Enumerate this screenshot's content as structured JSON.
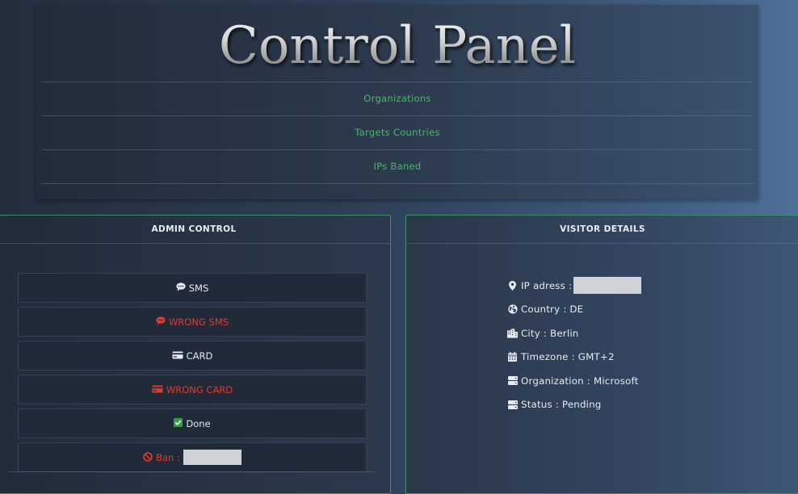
{
  "header": {
    "title": "Control Panel",
    "nav": [
      {
        "label": "Organizations"
      },
      {
        "label": "Targets Countries"
      },
      {
        "label": "IPs Baned"
      }
    ]
  },
  "admin": {
    "heading": "ADMIN CONTROL",
    "buttons": {
      "sms": {
        "label": "SMS",
        "icon": "chat-bubble-icon",
        "color": "#e6e9ee"
      },
      "wrong_sms": {
        "label": "WRONG SMS",
        "icon": "chat-bubble-icon",
        "color": "#e03a2f"
      },
      "card": {
        "label": "CARD",
        "icon": "credit-card-icon",
        "color": "#e6e9ee"
      },
      "wrong_card": {
        "label": "WRONG CARD",
        "icon": "credit-card-icon",
        "color": "#e03a2f"
      },
      "done": {
        "label": "Done",
        "icon": "checkbox-icon",
        "color": "#35a04a"
      },
      "ban": {
        "label": "Ban :",
        "icon": "ban-icon",
        "color": "#e03a2f"
      }
    }
  },
  "visitor": {
    "heading": "VISITOR DETAILS",
    "ip": {
      "label": "IP adress :",
      "icon": "map-marker-icon"
    },
    "country": {
      "label": "Country :",
      "value": "DE",
      "icon": "globe-icon"
    },
    "city": {
      "label": "City :",
      "value": "Berlin",
      "icon": "city-icon"
    },
    "timezone": {
      "label": "Timezone :",
      "value": "GMT+2",
      "icon": "calendar-icon"
    },
    "organization": {
      "label": "Organization :",
      "value": "Microsoft",
      "icon": "server-icon"
    },
    "status": {
      "label": "Status :",
      "value": "Pending",
      "icon": "server-icon"
    }
  },
  "colors": {
    "link_green": "#4fb56a",
    "danger_red": "#e03a2f",
    "panel_border": "#3f8f6a"
  }
}
